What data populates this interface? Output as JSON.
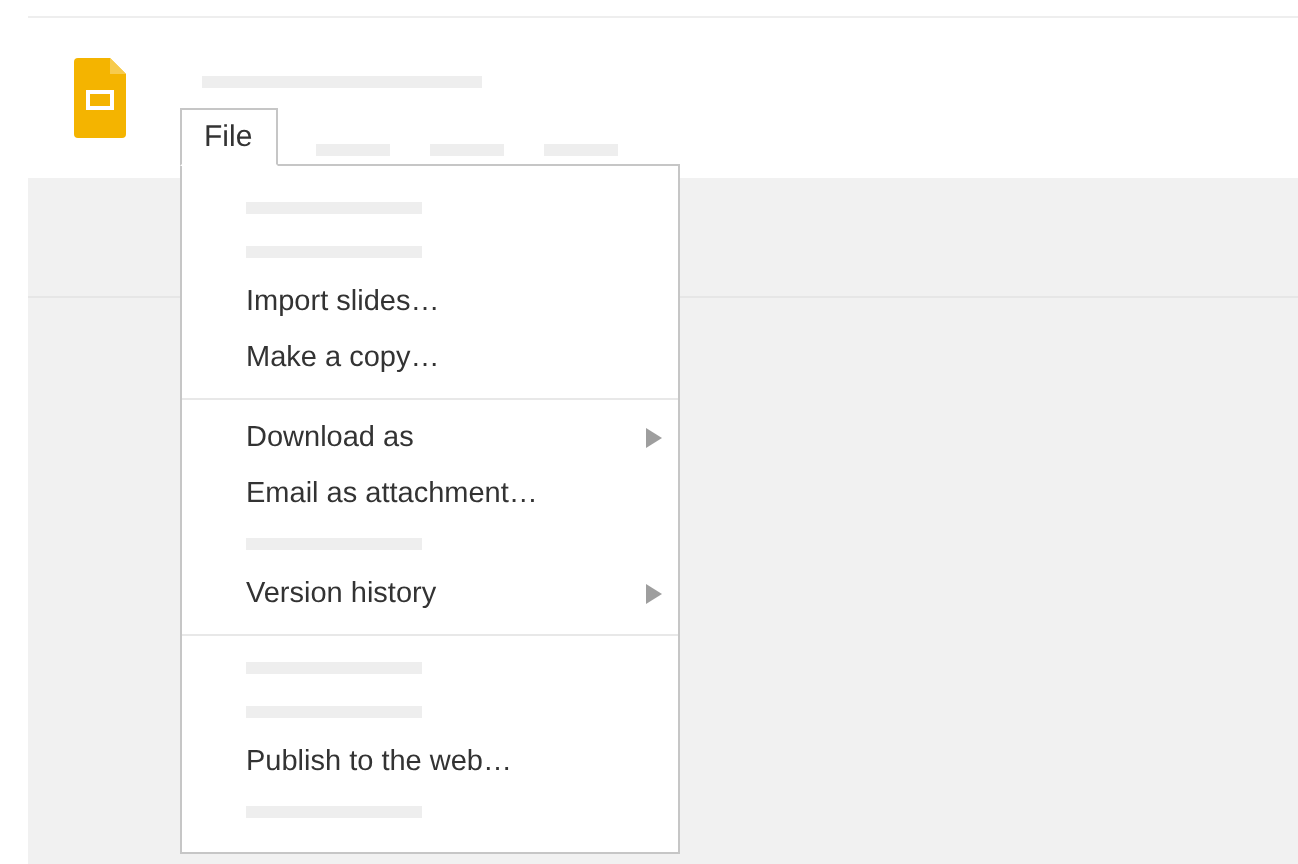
{
  "menu_tab": {
    "label": "File",
    "selected": true
  },
  "menu_items": [
    {
      "kind": "placeholder"
    },
    {
      "kind": "placeholder"
    },
    {
      "kind": "item",
      "label": "Import slides…",
      "submenu": false
    },
    {
      "kind": "item",
      "label": "Make a copy…",
      "submenu": false
    },
    {
      "kind": "separator"
    },
    {
      "kind": "item",
      "label": "Download as",
      "submenu": true
    },
    {
      "kind": "item",
      "label": "Email as attachment…",
      "submenu": false
    },
    {
      "kind": "placeholder"
    },
    {
      "kind": "item",
      "label": "Version history",
      "submenu": true
    },
    {
      "kind": "separator"
    },
    {
      "kind": "placeholder"
    },
    {
      "kind": "placeholder"
    },
    {
      "kind": "item",
      "label": "Publish to the web…",
      "submenu": false
    },
    {
      "kind": "placeholder"
    }
  ]
}
